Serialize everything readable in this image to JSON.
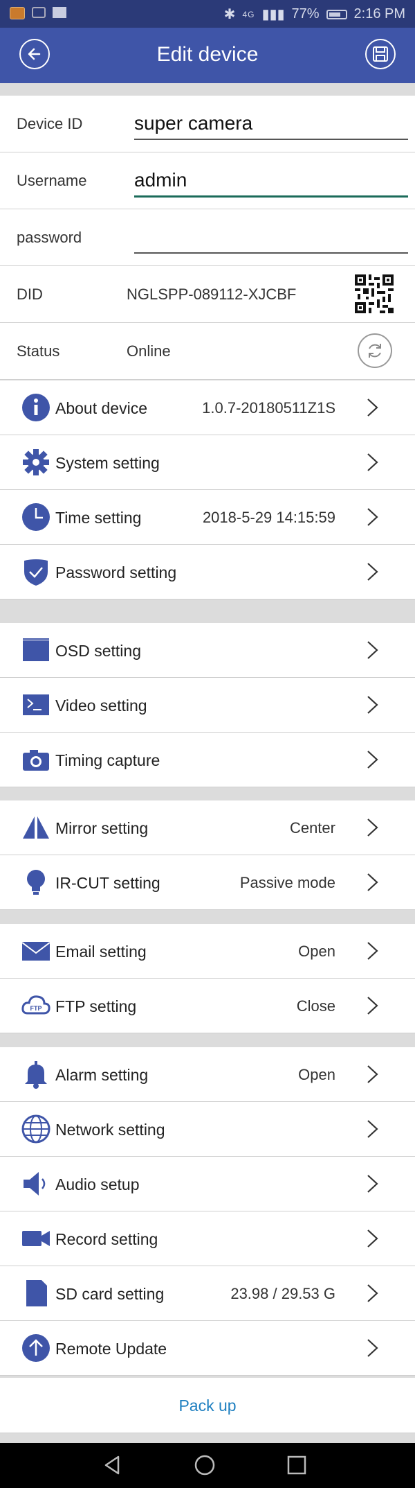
{
  "statusbar": {
    "network": "4G",
    "battery": "77%",
    "time": "2:16 PM"
  },
  "appbar": {
    "title": "Edit device",
    "back_icon": "back-arrow-icon",
    "save_icon": "save-icon"
  },
  "form": {
    "device_id_label": "Device ID",
    "device_id_value": "super camera",
    "username_label": "Username",
    "username_value": "admin",
    "password_label": "password",
    "password_value": "",
    "did_label": "DID",
    "did_value": "NGLSPP-089112-XJCBF",
    "status_label": "Status",
    "status_value": "Online"
  },
  "menu": [
    {
      "label": "About device",
      "value": "1.0.7-20180511Z1S",
      "icon": "info-icon"
    },
    {
      "label": "System setting",
      "value": "",
      "icon": "gear-icon"
    },
    {
      "label": "Time setting",
      "value": "2018-5-29 14:15:59",
      "icon": "clock-icon"
    },
    {
      "label": "Password setting",
      "value": "",
      "icon": "shield-icon"
    },
    {
      "label": "OSD setting",
      "value": "",
      "icon": "screen-icon"
    },
    {
      "label": "Video setting",
      "value": "",
      "icon": "terminal-icon"
    },
    {
      "label": "Timing capture",
      "value": "",
      "icon": "camera-icon"
    },
    {
      "label": "Mirror setting",
      "value": "Center",
      "icon": "mirror-icon"
    },
    {
      "label": "IR-CUT setting",
      "value": "Passive mode",
      "icon": "bulb-icon"
    },
    {
      "label": "Email setting",
      "value": "Open",
      "icon": "envelope-icon"
    },
    {
      "label": "FTP setting",
      "value": "Close",
      "icon": "ftp-cloud-icon"
    },
    {
      "label": "Alarm setting",
      "value": "Open",
      "icon": "bell-icon"
    },
    {
      "label": "Network setting",
      "value": "",
      "icon": "globe-icon"
    },
    {
      "label": "Audio setup",
      "value": "",
      "icon": "speaker-icon"
    },
    {
      "label": "Record setting",
      "value": "",
      "icon": "video-camera-icon"
    },
    {
      "label": "SD card setting",
      "value": "23.98 / 29.53 G",
      "icon": "sd-card-icon"
    },
    {
      "label": "Remote Update",
      "value": "",
      "icon": "upload-arrow-icon"
    }
  ],
  "pack_up": "Pack up",
  "colors": {
    "appbar": "#3f55a8",
    "statusbar": "#2b3a78",
    "icon": "#3f55a8",
    "link": "#1e7fc0",
    "active_underline": "#1b6b5a"
  }
}
